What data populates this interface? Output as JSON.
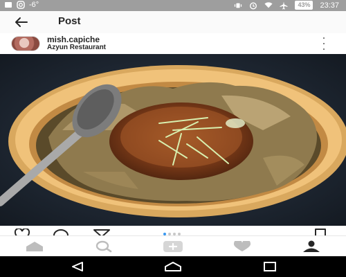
{
  "status_bar": {
    "signal_text": "-6°",
    "battery": "43%",
    "time": "23:37"
  },
  "app_bar": {
    "title": "Post"
  },
  "post": {
    "username": "mish.capiche",
    "location": "Azyun Restaurant"
  },
  "colors": {
    "accent": "#262626",
    "status_bar": "#9e9e9e",
    "nav_inactive": "#bdbdbd"
  },
  "icons": {
    "status": [
      "notification-icon",
      "instagram-icon",
      "vibrate-icon",
      "alarm-icon",
      "wifi-icon",
      "airplane-icon",
      "battery-icon"
    ],
    "actions": [
      "heart-icon",
      "comment-icon",
      "share-icon",
      "bookmark-icon"
    ],
    "nav": [
      "home-icon",
      "search-icon",
      "add-icon",
      "activity-heart-icon",
      "profile-icon"
    ],
    "system": [
      "back-triangle-icon",
      "home-circle-icon",
      "recents-square-icon"
    ]
  }
}
